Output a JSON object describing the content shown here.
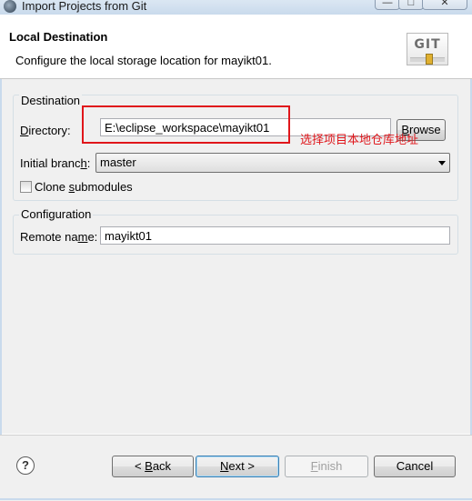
{
  "window": {
    "title": "Import Projects from Git",
    "min_glyph": "—",
    "max_glyph": "□",
    "close_glyph": "✕"
  },
  "header": {
    "title": "Local Destination",
    "description": "Configure the local storage location for mayikt01.",
    "logo_text": "GIT"
  },
  "destination": {
    "group_label": "Destination",
    "directory_label_prefix": "D",
    "directory_label_rest": "irectory:",
    "directory_value": "E:\\eclipse_workspace\\mayikt01",
    "browse_prefix": "B",
    "browse_rest": "rowse",
    "branch_label_prefix": "Initial branc",
    "branch_label_u": "h",
    "branch_label_suffix": ":",
    "branch_value": "master",
    "clone_prefix": "Clone ",
    "clone_u": "s",
    "clone_rest": "ubmodules"
  },
  "configuration": {
    "group_label": "Configuration",
    "remote_label_prefix": "Remote na",
    "remote_label_u": "m",
    "remote_label_suffix": "e:",
    "remote_value": "mayikt01"
  },
  "annotation": {
    "text": "选择项目本地仓库地址",
    "color": "#e0161b"
  },
  "footer": {
    "help_glyph": "?",
    "back_prefix": "< ",
    "back_u": "B",
    "back_rest": "ack",
    "next_u": "N",
    "next_rest": "ext >",
    "finish_u": "F",
    "finish_rest": "inish",
    "cancel_label": "Cancel"
  }
}
